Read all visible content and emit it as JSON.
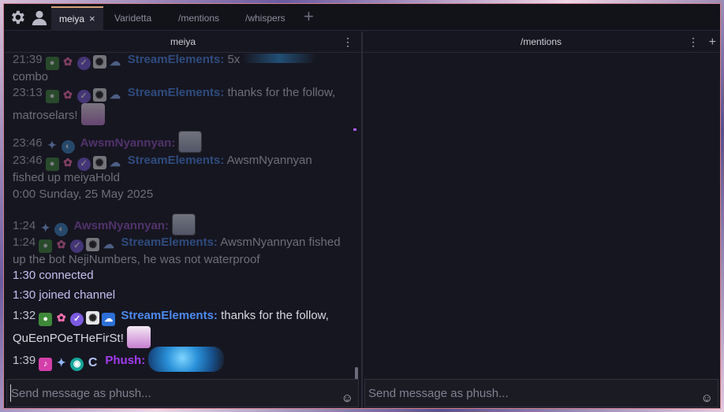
{
  "tabs": [
    {
      "label": "meiya",
      "active": true,
      "close": "×"
    },
    {
      "label": "Varidetta"
    },
    {
      "label": "/mentions"
    },
    {
      "label": "/whispers"
    }
  ],
  "tab_add": "+",
  "icons": {
    "settings": "gear-icon",
    "account": "user-icon"
  },
  "left_split": {
    "title": "meiya",
    "menu": "⋮",
    "input_placeholder": "Send message as phush...",
    "emoji": "☺"
  },
  "right_split": {
    "title": "/mentions",
    "menu": "⋮",
    "add": "+",
    "input_placeholder": "Send message as phush...",
    "emoji": "☺"
  },
  "messages": {
    "m1": {
      "time": "21:39",
      "user": "StreamElements:",
      "text": "5x",
      "text2": "combo"
    },
    "m2": {
      "time": "23:13",
      "user": "StreamElements:",
      "text": "thanks for the follow,",
      "text2": "matroselars!"
    },
    "m3": {
      "time": "23:46",
      "user": "AwsmNyannyan:"
    },
    "m4": {
      "time": "23:46",
      "user": "StreamElements:",
      "text": "AwsmNyannyan",
      "text2": "fished up meiyaHold"
    },
    "m5": {
      "text": "0:00 Sunday, 25 May 2025"
    },
    "m6": {
      "time": "1:24",
      "user": "AwsmNyannyan:"
    },
    "m7": {
      "time": "1:24",
      "user": "StreamElements:",
      "text": "AwsmNyannyan fished",
      "text2": "up the bot NejiNumbers, he was not waterproof"
    },
    "m8": {
      "text": "1:30 connected"
    },
    "m9": {
      "text": "1:30 joined channel"
    },
    "m10": {
      "time": "1:32",
      "user": "StreamElements:",
      "text": "thanks for the follow,",
      "text2": "QuEenPOeTHeFirSt!"
    },
    "m11": {
      "time": "1:39",
      "user": "Phush:"
    }
  },
  "colors": {
    "streamelements": "#4d8bf0",
    "awsm": "#9a55c6",
    "phush": "#a33cf0",
    "tab_accent": "#d7a57a",
    "window_border": "#d07f8e"
  }
}
